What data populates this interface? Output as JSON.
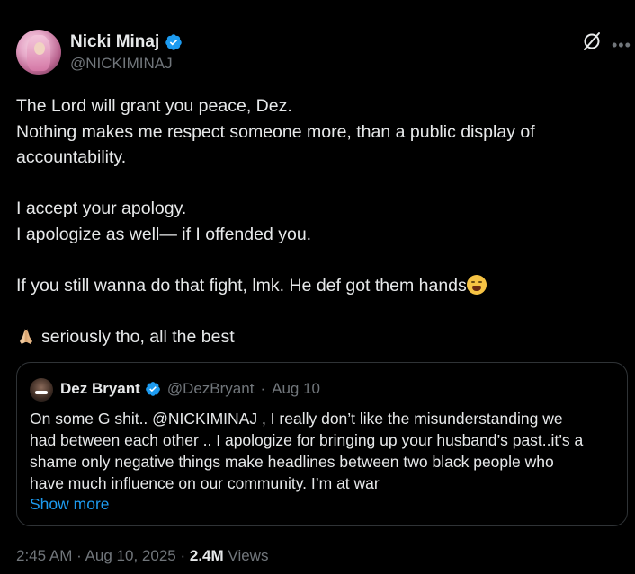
{
  "author": {
    "display_name": "Nicki Minaj",
    "handle": "@NICKIMINAJ"
  },
  "icons": {
    "verified": "verified-badge-icon",
    "grok": "grok-icon",
    "more": "more-icon"
  },
  "tweet": {
    "lines": [
      "The Lord will grant you peace, Dez.",
      "Nothing makes me respect someone more, than a public display of",
      "accountability.",
      "I accept your apology.",
      "I apologize as well—  if I offended you.",
      "If you still wanna do that fight, lmk. He def got them hands",
      "seriously tho, all the best"
    ]
  },
  "quote": {
    "display_name": "Dez Bryant",
    "handle": "@DezBryant",
    "separator": "·",
    "date": "Aug 10",
    "text_lines": [
      "On some G shit.. @NICKIMINAJ , I really don’t like the misunderstanding we",
      "had between each other .. I apologize for bringing up your husband’s past..it’s a",
      "shame only negative things make headlines between two black people who",
      "have much influence on our community. I’m at war"
    ],
    "show_more": "Show more"
  },
  "footer": {
    "time": "2:45 AM",
    "sep1": "·",
    "date": "Aug 10, 2025",
    "sep2": "·",
    "views_count": "2.4M",
    "views_label": "Views"
  },
  "colors": {
    "background": "#000000",
    "text": "#e7e9ea",
    "muted": "#71767b",
    "accent": "#1d9bf0",
    "border": "#2f3336"
  }
}
